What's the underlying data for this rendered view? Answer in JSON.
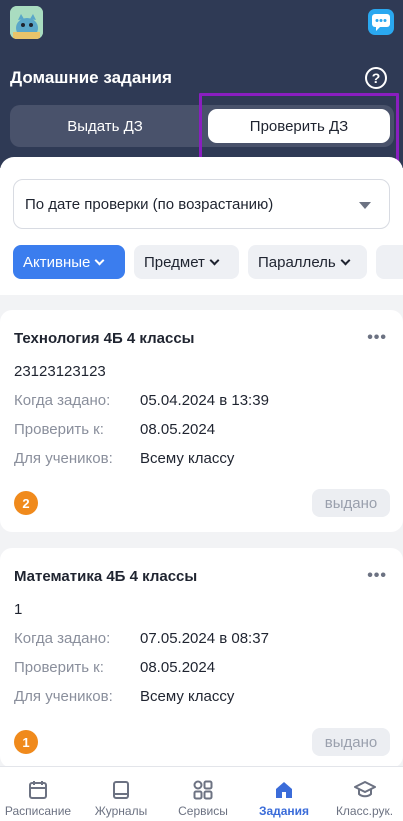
{
  "header": {
    "title": "Домашние задания",
    "help_icon_text": "?",
    "tabs": [
      {
        "label": "Выдать ДЗ",
        "active": false
      },
      {
        "label": "Проверить ДЗ",
        "active": true
      }
    ]
  },
  "filters": {
    "sort_value": "По дате проверки (по возрастанию)",
    "chips": [
      {
        "label": "Активные",
        "active": true
      },
      {
        "label": "Предмет",
        "active": false
      },
      {
        "label": "Параллель",
        "active": false
      }
    ]
  },
  "labels": {
    "assigned": "Когда задано:",
    "check_by": "Проверить к:",
    "for_students": "Для учеников:"
  },
  "cards": [
    {
      "title": "Технология 4Б 4 классы",
      "text": "23123123123",
      "assigned": "05.04.2024 в 13:39",
      "check_by": "08.05.2024",
      "for_students": "Всему классу",
      "badge": "2",
      "status": "выдано",
      "more": "•••"
    },
    {
      "title": "Математика 4Б 4 классы",
      "text": "1",
      "assigned": "07.05.2024 в 08:37",
      "check_by": "08.05.2024",
      "for_students": "Всему классу",
      "badge": "1",
      "status": "выдано",
      "more": "•••"
    }
  ],
  "nav": [
    {
      "label": "Расписание",
      "icon": "calendar-icon",
      "active": false
    },
    {
      "label": "Журналы",
      "icon": "book-icon",
      "active": false
    },
    {
      "label": "Сервисы",
      "icon": "grid-icon",
      "active": false
    },
    {
      "label": "Задания",
      "icon": "house-icon",
      "active": true
    },
    {
      "label": "Класс.рук.",
      "icon": "graduation-cap-icon",
      "active": false
    }
  ],
  "colors": {
    "header_bg": "#2f3a55",
    "accent": "#3b7dee",
    "highlight": "#8a1ec0",
    "badge": "#f08a1c"
  }
}
